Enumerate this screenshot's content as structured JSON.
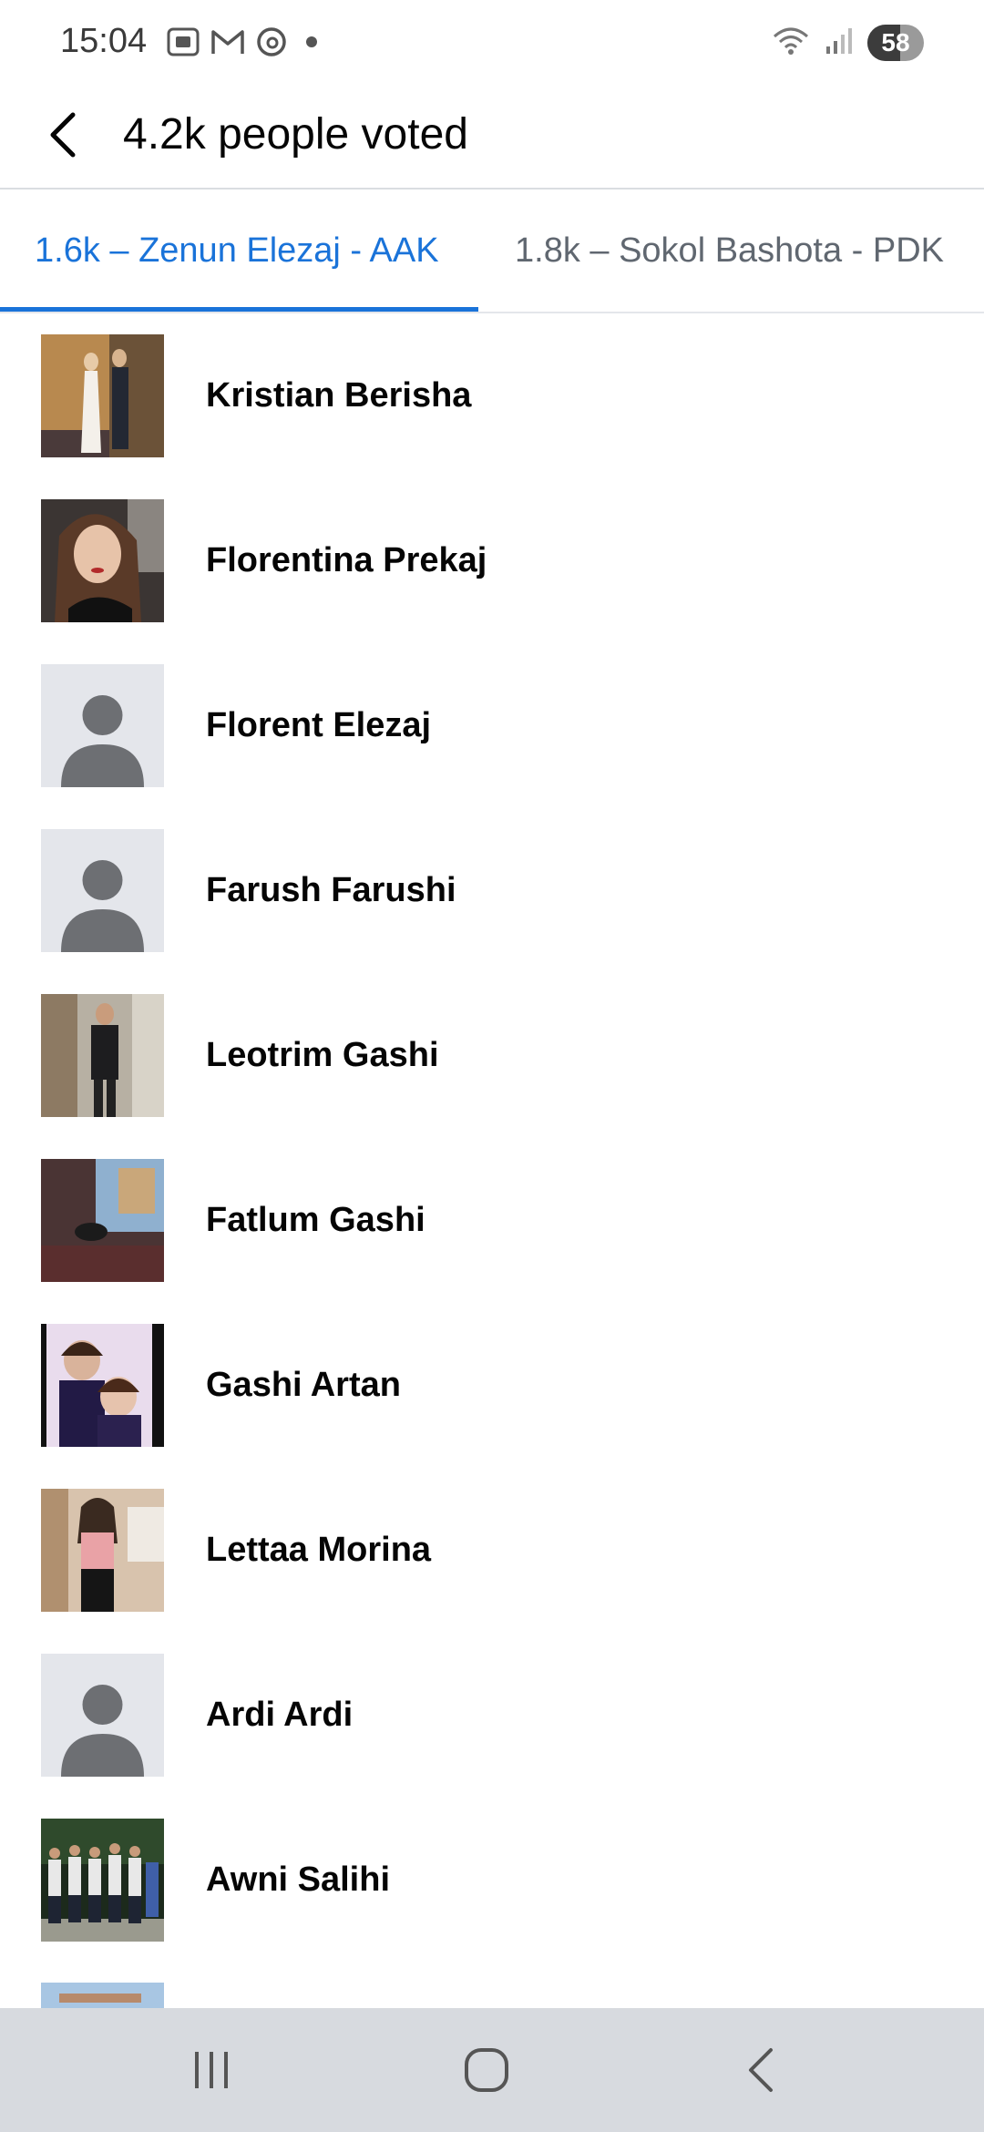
{
  "status_bar": {
    "time": "15:04",
    "battery": "58",
    "battery_level": 0.58
  },
  "header": {
    "title": "4.2k people voted"
  },
  "tabs": [
    {
      "label": "1.6k – Zenun Elezaj - AAK",
      "selected": true
    },
    {
      "label": "1.8k – Sokol Bashota - PDK",
      "selected": false
    }
  ],
  "voters": [
    {
      "name": "Kristian Berisha",
      "avatar": "photo-couple"
    },
    {
      "name": "Florentina Prekaj",
      "avatar": "photo-woman"
    },
    {
      "name": "Florent Elezaj",
      "avatar": "default-avatar"
    },
    {
      "name": "Farush Farushi",
      "avatar": "default-avatar"
    },
    {
      "name": "Leotrim Gashi",
      "avatar": "photo-man"
    },
    {
      "name": "Fatlum Gashi",
      "avatar": "photo-window"
    },
    {
      "name": "Gashi Artan",
      "avatar": "photo-children"
    },
    {
      "name": "Lettaa Morina",
      "avatar": "photo-selfie"
    },
    {
      "name": "Ardi Ardi",
      "avatar": "default-avatar"
    },
    {
      "name": "Awni Salihi",
      "avatar": "photo-group"
    }
  ],
  "colors": {
    "accent": "#1a73d9",
    "text": "#050505",
    "secondary_text": "#606770",
    "nav_bar": "#d7dadf"
  }
}
